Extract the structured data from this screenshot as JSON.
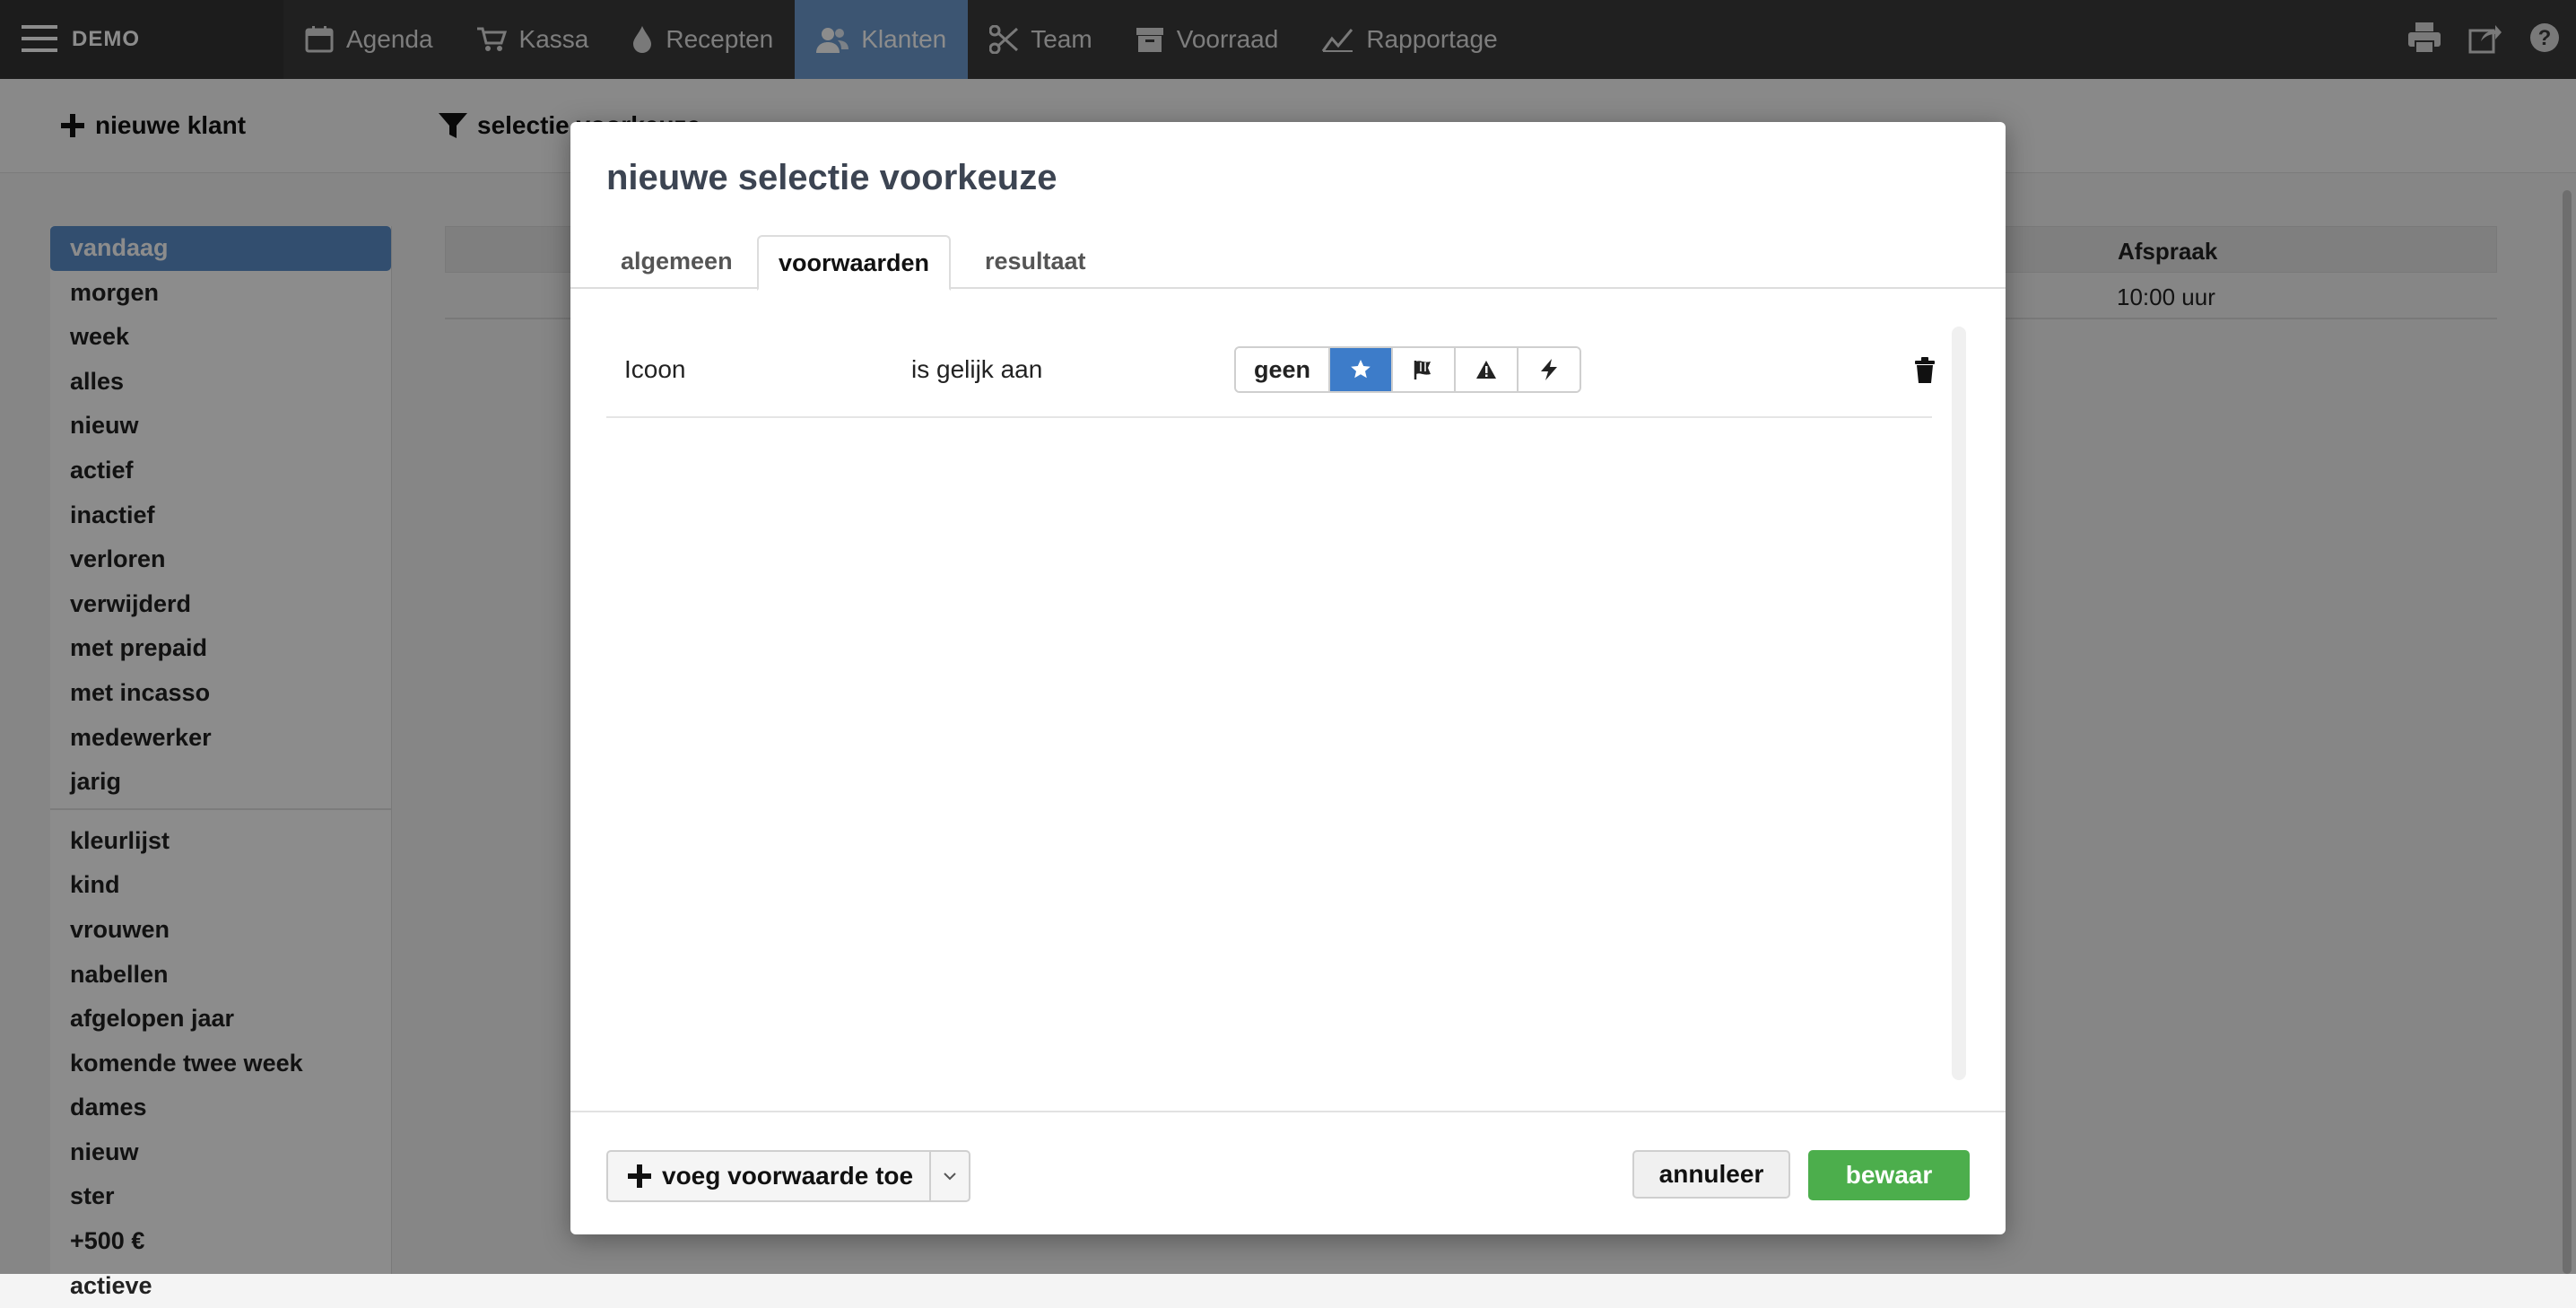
{
  "app": {
    "brand": "DEMO"
  },
  "nav": [
    {
      "label": "Agenda",
      "icon": "calendar-icon"
    },
    {
      "label": "Kassa",
      "icon": "cart-icon"
    },
    {
      "label": "Recepten",
      "icon": "drop-icon"
    },
    {
      "label": "Klanten",
      "icon": "users-icon",
      "active": true
    },
    {
      "label": "Team",
      "icon": "scissors-icon"
    },
    {
      "label": "Voorraad",
      "icon": "box-icon"
    },
    {
      "label": "Rapportage",
      "icon": "chart-line-icon"
    }
  ],
  "top_actions": [
    "print-icon",
    "share-icon",
    "help-icon"
  ],
  "toolbar": {
    "new_client": "nieuwe klant",
    "selection": "selectie voorkeuze"
  },
  "sidebar": {
    "group1": [
      "vandaag",
      "morgen",
      "week",
      "alles",
      "nieuw",
      "actief",
      "inactief",
      "verloren",
      "verwijderd",
      "met prepaid",
      "met incasso",
      "medewerker",
      "jarig"
    ],
    "group2": [
      "kleurlijst",
      "kind",
      "vrouwen",
      "nabellen",
      "afgelopen jaar",
      "komende twee week",
      "dames",
      "nieuw",
      "ster",
      "+500 €",
      "actieve"
    ]
  },
  "table": {
    "col_appointment": "Afspraak",
    "row1_appointment": "10:00 uur"
  },
  "modal": {
    "title": "nieuwe selectie voorkeuze",
    "tabs": [
      "algemeen",
      "voorwaarden",
      "resultaat"
    ],
    "active_tab": "voorwaarden",
    "condition": {
      "field": "Icoon",
      "operator": "is gelijk aan",
      "options": [
        "geen",
        "star-icon",
        "flag-icon",
        "warning-icon",
        "bolt-icon"
      ],
      "selected": "star-icon"
    },
    "add_condition": "voeg voorwaarde toe",
    "cancel": "annuleer",
    "save": "bewaar"
  },
  "colors": {
    "accent": "#3d7cc9",
    "save": "#4cae4c",
    "nav_active": "#6e9ccf"
  }
}
